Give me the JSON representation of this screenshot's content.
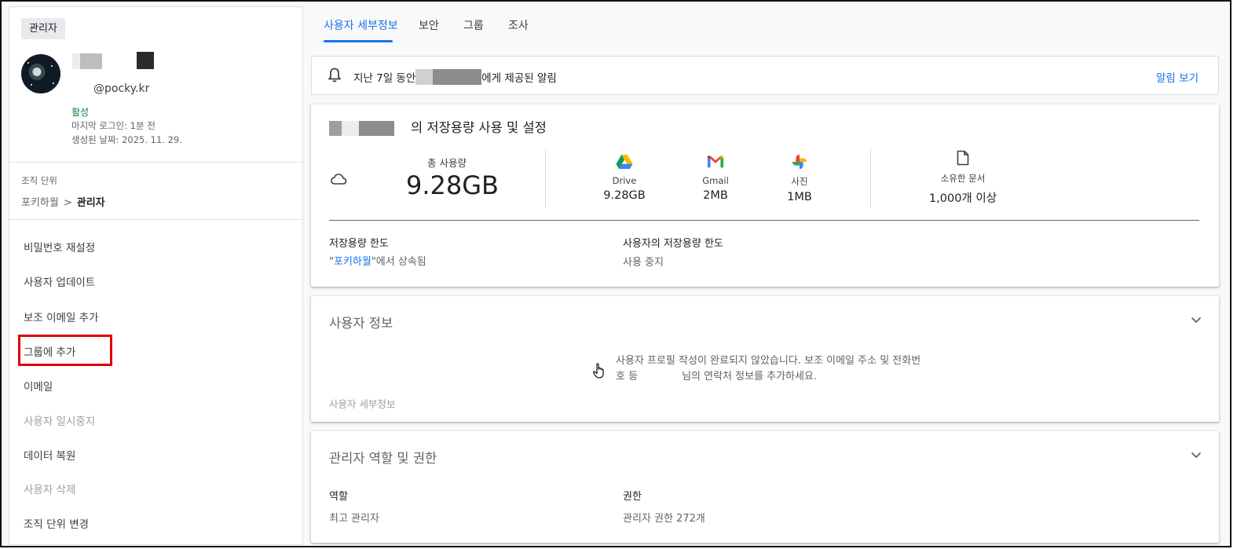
{
  "sidebar": {
    "role_chip": "관리자",
    "user_email": "@pocky.kr",
    "status": "활성",
    "last_login": "마지막 로그인: 1분 전",
    "created": "생성된 날짜: 2025. 11. 29.",
    "org_label": "조직 단위",
    "org_path": {
      "parent": "포키하월",
      "separator": ">",
      "current": "관리자"
    },
    "actions": [
      {
        "label": "비밀번호 재설정",
        "enabled": true
      },
      {
        "label": "사용자 업데이트",
        "enabled": true
      },
      {
        "label": "보조 이메일 추가",
        "enabled": true
      },
      {
        "label": "그룹에 추가",
        "enabled": true,
        "highlighted": true
      },
      {
        "label": "이메일",
        "enabled": true
      },
      {
        "label": "사용자 일시중지",
        "enabled": false
      },
      {
        "label": "데이터 복원",
        "enabled": true
      },
      {
        "label": "사용자 삭제",
        "enabled": false
      },
      {
        "label": "조직 단위 변경",
        "enabled": true
      }
    ]
  },
  "tabs": [
    {
      "label": "사용자 세부정보",
      "active": true
    },
    {
      "label": "보안",
      "active": false
    },
    {
      "label": "그룹",
      "active": false
    },
    {
      "label": "조사",
      "active": false
    }
  ],
  "alert": {
    "text_before": "지난 7일 동안",
    "text_after": "에게 제공된 알림",
    "link": "알림 보기"
  },
  "storage": {
    "title": "의 저장용량 사용 및 설정",
    "total_label": "총 사용량",
    "total_value": "9.28GB",
    "services": [
      {
        "name": "Drive",
        "value": "9.28GB",
        "icon": "google-drive-icon"
      },
      {
        "name": "Gmail",
        "value": "2MB",
        "icon": "gmail-icon"
      },
      {
        "name": "사진",
        "value": "1MB",
        "icon": "google-photos-icon"
      }
    ],
    "owned_docs_label": "소유한 문서",
    "owned_docs_value": "1,000개 이상",
    "limit_label": "저장용량 한도",
    "limit_value_prefix": "\"",
    "limit_value_link": "포키하월",
    "limit_value_suffix": "\"에서 상속됨",
    "user_limit_label": "사용자의 저장용량 한도",
    "user_limit_value": "사용 중지"
  },
  "user_info": {
    "title": "사용자 정보",
    "message_line1": "사용자 프로필 작성이 완료되지 않았습니다. 보조 이메일 주소 및 전화번",
    "message_line2_a": "호 등",
    "message_line2_b": "님의 연락처 정보를 추가하세요.",
    "sub_link": "사용자 세부정보"
  },
  "admin_roles": {
    "title": "관리자 역할 및 권한",
    "role_label": "역할",
    "role_value": "최고 관리자",
    "perm_label": "권한",
    "perm_value": "관리자 권한 272개"
  },
  "colors": {
    "accent": "#1a73e8",
    "status_active": "#188038",
    "highlight": "#e00000"
  }
}
